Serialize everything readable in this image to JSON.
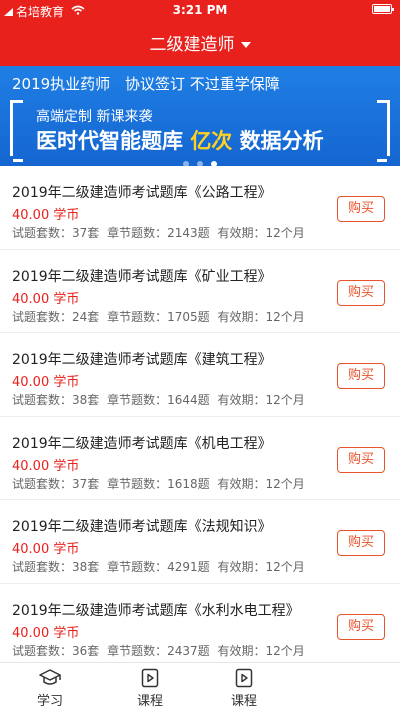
{
  "status_bar": {
    "carrier": "名培教育",
    "time": "3:21 PM",
    "battery_level": 1.0
  },
  "nav": {
    "title": "二级建造师"
  },
  "banner": {
    "line1_a": "2019执业药师",
    "line1_b": "协议签订 不过重学保障",
    "line2": "高端定制 新课来袭",
    "line3_a": "医时代智能题库",
    "line3_highlight": "亿次",
    "line3_b": "数据分析",
    "slide_count": 3,
    "active_slide": 3
  },
  "courses": [
    {
      "title": "2019年二级建造师考试题库《公路工程》",
      "price": "40.00 学币",
      "sets": "试题套数：37套",
      "chapters": "章节题数：2143题",
      "validity": "有效期：12个月",
      "buy_label": "购买"
    },
    {
      "title": "2019年二级建造师考试题库《矿业工程》",
      "price": "40.00 学币",
      "sets": "试题套数：24套",
      "chapters": "章节题数：1705题",
      "validity": "有效期：12个月",
      "buy_label": "购买"
    },
    {
      "title": "2019年二级建造师考试题库《建筑工程》",
      "price": "40.00 学币",
      "sets": "试题套数：38套",
      "chapters": "章节题数：1644题",
      "validity": "有效期：12个月",
      "buy_label": "购买"
    },
    {
      "title": "2019年二级建造师考试题库《机电工程》",
      "price": "40.00 学币",
      "sets": "试题套数：37套",
      "chapters": "章节题数：1618题",
      "validity": "有效期：12个月",
      "buy_label": "购买"
    },
    {
      "title": "2019年二级建造师考试题库《法规知识》",
      "price": "40.00 学币",
      "sets": "试题套数：38套",
      "chapters": "章节题数：4291题",
      "validity": "有效期：12个月",
      "buy_label": "购买"
    },
    {
      "title": "2019年二级建造师考试题库《水利水电工程》",
      "price": "40.00 学币",
      "sets": "试题套数：36套",
      "chapters": "章节题数：2437题",
      "validity": "有效期：12个月",
      "buy_label": "购买"
    }
  ],
  "tabs": [
    {
      "label": "学习",
      "icon": "graduation-cap-icon"
    },
    {
      "label": "课程",
      "icon": "play-document-icon"
    },
    {
      "label": "课程",
      "icon": "play-document-icon"
    }
  ],
  "colors": {
    "header_red": "#e8211c",
    "banner_blue": "#1f7fe4",
    "price_red": "#e8211c",
    "buy_orange": "#e8532c",
    "highlight_yellow": "#ffd21f"
  }
}
